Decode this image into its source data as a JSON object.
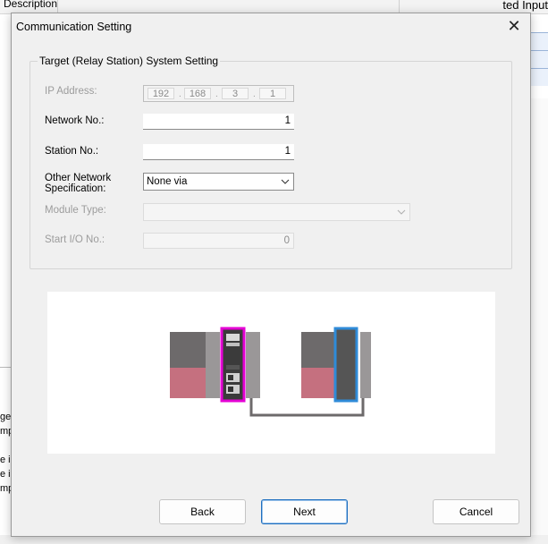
{
  "background": {
    "description_label": "Description",
    "right_header_text": "ted Input",
    "left_fragments": [
      "ge",
      "mp",
      "e is",
      "e is",
      "mp"
    ]
  },
  "dialog": {
    "title": "Communication Setting",
    "close_icon": "close-icon",
    "group_title": "Target (Relay Station) System Setting",
    "fields": {
      "ip_label": "IP Address:",
      "ip_octets": [
        "192",
        "168",
        "3",
        "1"
      ],
      "network_label": "Network No.:",
      "network_value": "1",
      "station_label": "Station No.:",
      "station_value": "1",
      "other_network_label_1": "Other Network",
      "other_network_label_2": "Specification:",
      "other_network_value": "None via",
      "module_type_label": "Module Type:",
      "module_type_value": "",
      "start_io_label": "Start I/O No.:",
      "start_io_value": "0"
    },
    "colors": {
      "highlight_cpu": "#e400d4",
      "highlight_module": "#2f8bd8",
      "module_pink": "#c5707f",
      "module_grey": "#6d6a6b"
    },
    "buttons": {
      "back": "Back",
      "next": "Next",
      "cancel": "Cancel"
    }
  }
}
